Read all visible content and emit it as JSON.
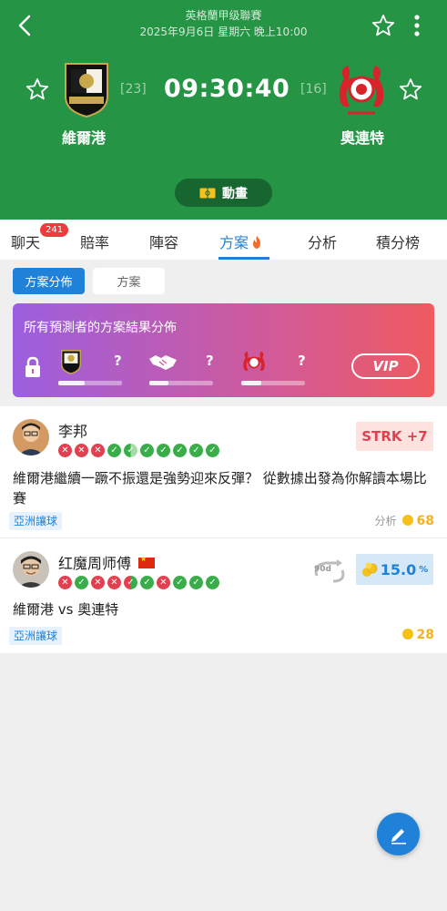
{
  "header": {
    "league": "英格蘭甲级聯賽",
    "datetime": "2025年9月6日 星期六 晚上10:00",
    "match_time": "09:30:40",
    "home": {
      "name": "維爾港",
      "rank": "[23]",
      "logo_text": "PORT VALE F.C."
    },
    "away": {
      "name": "奧連特",
      "rank": "[16]"
    },
    "animation_label": "動畫"
  },
  "tabs": [
    {
      "label": "聊天",
      "badge": "241"
    },
    {
      "label": "賠率"
    },
    {
      "label": "陣容"
    },
    {
      "label": "方案",
      "active": true
    },
    {
      "label": "分析"
    },
    {
      "label": "積分榜"
    }
  ],
  "segments": {
    "distribution": "方案分佈",
    "plans": "方案"
  },
  "vip_card": {
    "title": "所有預測者的方案結果分佈",
    "home_value": "?",
    "draw_value": "?",
    "away_value": "?",
    "vip_label": "VIP"
  },
  "plans": [
    {
      "author": "李邦",
      "record": [
        "l",
        "l",
        "l",
        "w",
        "hw",
        "w",
        "w",
        "w",
        "w",
        "w"
      ],
      "badge": "STRK +7",
      "title": "維爾港繼續一蹶不振還是強勢迎來反彈？ 從數據出發為你解讀本場比賽",
      "tag": "亞洲讓球",
      "price_label": "分析",
      "price": "68"
    },
    {
      "author": "红魔周师傅",
      "record": [
        "l",
        "w",
        "l",
        "l",
        "h",
        "w",
        "l",
        "w",
        "w",
        "w"
      ],
      "badge_90d": "90d",
      "roi": "15.0",
      "roi_unit": "%",
      "title": "維爾港 vs 奧連特",
      "tag": "亞洲讓球",
      "price": "28"
    }
  ],
  "colors": {
    "header_bg": "#259445",
    "accent": "#1f82d8",
    "loss": "#e04150",
    "win": "#3aad4a",
    "coin": "#f5c11a"
  }
}
